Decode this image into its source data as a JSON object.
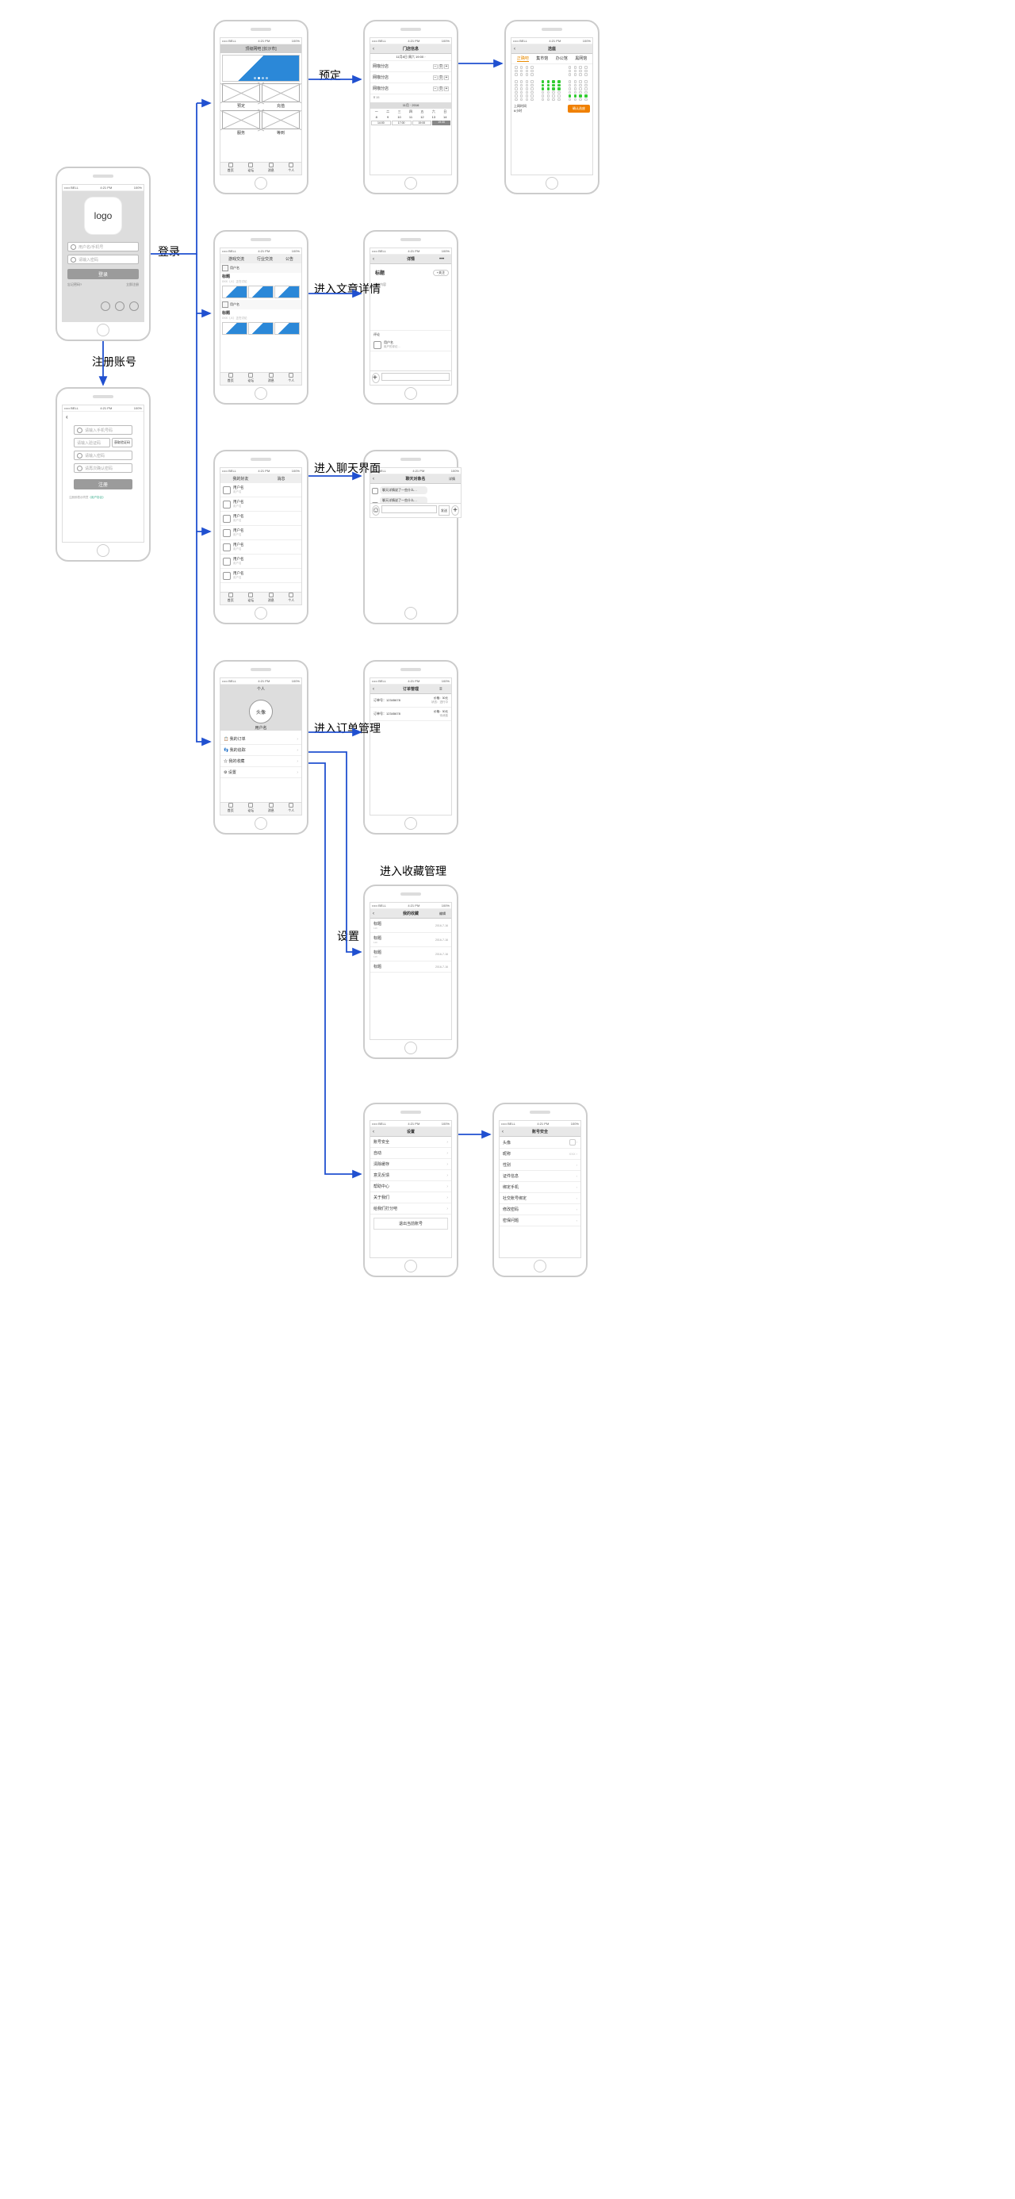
{
  "status": {
    "carrier": "••••• BELL",
    "signal": "⇡",
    "time": "4:21 PM",
    "battery": "100%"
  },
  "labels": {
    "login": "登录",
    "register_account": "注册账号",
    "reserve": "预定",
    "enter_article": "进入文章详情",
    "enter_chat": "进入聊天界面",
    "enter_orders": "进入订单管理",
    "enter_favorites": "进入收藏管理",
    "settings": "设置"
  },
  "login": {
    "logo": "logo",
    "username_ph": "用户名/手机号",
    "password_ph": "请输入密码",
    "btn": "登录",
    "forgot": "忘记密码?",
    "register_now": "立即注册"
  },
  "register": {
    "back": "‹",
    "phone_ph": "请输入手机号码",
    "code_ph": "请输入验证码",
    "get_code": "获取验证码",
    "pwd_ph": "请输入密码",
    "pwd2_ph": "请再次确认密码",
    "btn": "注册",
    "tos": "注册即表示同意",
    "tos_link": "《用户协议》"
  },
  "home": {
    "title1": "顶级网吧",
    "title2": "[长沙市]",
    "grid": [
      "预定",
      "充值",
      "服务",
      "等到"
    ],
    "tabs": [
      "首页",
      "论坛",
      "消息",
      "个人"
    ]
  },
  "shop": {
    "title": "门店信息",
    "date_line": "11月8日 周六 19:00",
    "rows": [
      "网咖分店",
      "网咖分店",
      "网咖分店"
    ],
    "price": "￥15",
    "month": "11月 · 2016",
    "weekdays": [
      "一",
      "二",
      "三",
      "四",
      "五",
      "六",
      "日"
    ],
    "dates": [
      "8",
      "9",
      "10",
      "11",
      "12",
      "13",
      "14"
    ],
    "times": [
      "14:00",
      "17:00",
      "19:00",
      "19:30"
    ]
  },
  "seat": {
    "title": "选座",
    "tabs": [
      "正确吧",
      "集市馆",
      "办公馆",
      "黑网馆"
    ],
    "time_label": "上网时间",
    "time_val": "6小时",
    "btn": "确认选座"
  },
  "forum": {
    "tabs": [
      "游戏交流",
      "行业交流",
      "公告"
    ],
    "avatar": "头像",
    "user": "用户名",
    "title": "标题",
    "sub": "XXX（人）正在讨论"
  },
  "detail": {
    "nav": "详情",
    "title": "标题",
    "tag": "+关注",
    "section": "辩诸内容",
    "comment_label": "评论",
    "user": "用户名",
    "comment": "用户的评论…"
  },
  "messages": {
    "tabs": [
      "我的好友",
      "消息"
    ],
    "user": "用户名",
    "avatar": "头像"
  },
  "chat": {
    "nav": "聊天对象名",
    "right": "详情",
    "bubble": "聊天详情说了一些什么…",
    "send": "发送"
  },
  "profile": {
    "nav": "个人",
    "avatar": "头像",
    "username": "用户名",
    "items": [
      "我的订单",
      "我的追踪",
      "我的收藏",
      "设置"
    ]
  },
  "orders": {
    "nav": "订单管理",
    "id_label": "订单号：",
    "id1": "12345678",
    "id2": "12345678",
    "price_label": "价格：30元",
    "status1": "状态：进行中",
    "status2": "待消费"
  },
  "favorites": {
    "nav": "我的收藏",
    "right": "编辑",
    "title": "标题",
    "date": "2016-7-16",
    "views": "116"
  },
  "settings": {
    "nav": "设置",
    "items": [
      "账号安全",
      "自动",
      "清除缓存",
      "意见反馈",
      "帮助中心",
      "关于我们",
      "给我们打分吧"
    ],
    "logout": "退出当前账号"
  },
  "security": {
    "nav": "账号安全",
    "items": [
      "头像",
      "昵称",
      "性别",
      "证件信息",
      "绑定手机",
      "社交账号绑定",
      "修改密码",
      "密保问题"
    ],
    "values": [
      "头像",
      "XXX",
      "",
      "",
      "",
      "",
      "",
      ""
    ]
  }
}
